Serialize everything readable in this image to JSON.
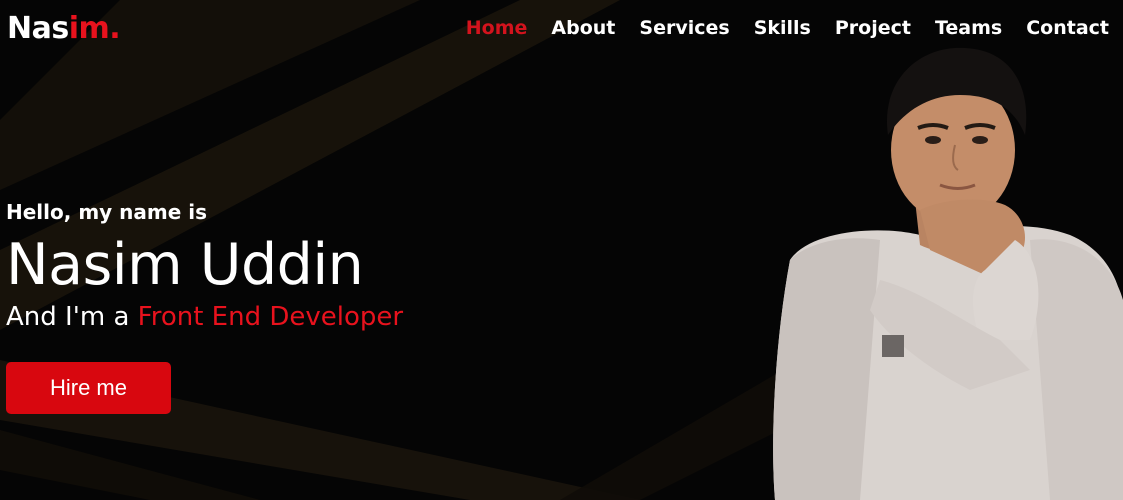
{
  "logo": {
    "part1": "Nas",
    "part2": "im."
  },
  "nav": {
    "items": [
      {
        "label": "Home",
        "active": true
      },
      {
        "label": "About",
        "active": false
      },
      {
        "label": "Services",
        "active": false
      },
      {
        "label": "Skills",
        "active": false
      },
      {
        "label": "Project",
        "active": false
      },
      {
        "label": "Teams",
        "active": false
      },
      {
        "label": "Contact",
        "active": false
      }
    ]
  },
  "hero": {
    "greeting": "Hello, my name is",
    "name": "Nasim Uddin",
    "role_prefix": "And I'm a ",
    "role_highlight": "Front End Developer",
    "cta_label": "Hire me"
  },
  "colors": {
    "accent": "#e8121d",
    "nav_active": "#d3131d",
    "button": "#d8070f",
    "background": "#050505"
  },
  "images": {
    "portrait": "person-portrait-photo"
  }
}
